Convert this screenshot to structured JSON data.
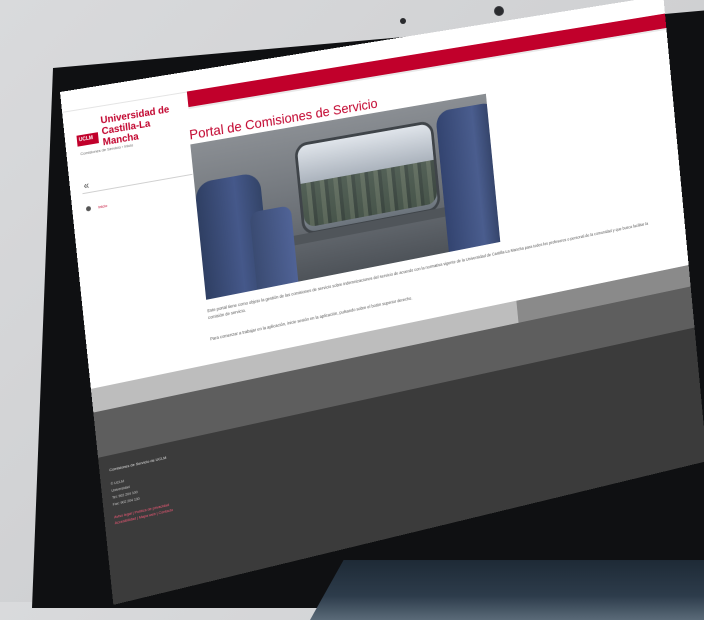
{
  "browser": {
    "url": "",
    "camera_label": ""
  },
  "header": {
    "logo_badge": "UCLM",
    "university_name": "Universidad de Castilla-La Mancha",
    "subtitle": "Comisiones de Servicio › Inicio",
    "accent_color": "#c1002b"
  },
  "sidebar": {
    "collapse_icon": "«",
    "home_label": "Inicio"
  },
  "main": {
    "title": "Portal de Comisiones de Servicio",
    "paragraph_1": "Este portal tiene como objeto la gestión de las comisiones de servicio sobre indemnizaciones del servicio de acuerdo con la normativa vigente de la Universidad de Castilla-La Mancha para todos los profesores o personal de la comunidad y que busca facilitar la comisión de servicio.",
    "paragraph_2": "Para comenzar a trabajar en la aplicación, inicie sesión en la aplicación, pulsando sobre el botón superior derecho."
  },
  "footer": {
    "title": "Comisiones de Servicio de UCLM",
    "line_1": "© UCLM",
    "line_2": "Universidad",
    "line_3": "Tel: 902 204 100",
    "line_4": "Fax: 902 204 130",
    "link_1": "Aviso legal | Política de privacidad",
    "link_2": "Accesibilidad | Mapa web | Contacto"
  }
}
